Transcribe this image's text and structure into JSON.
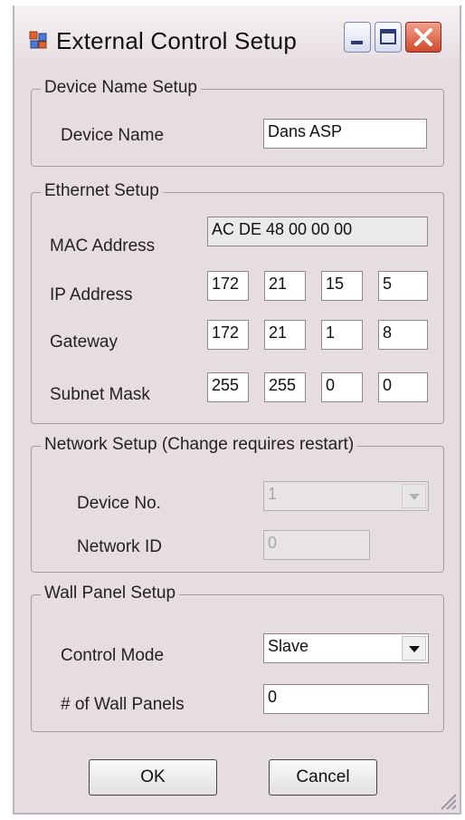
{
  "window": {
    "title": "External Control Setup"
  },
  "device_name_setup": {
    "legend": "Device Name Setup",
    "device_name_label": "Device Name",
    "device_name_value": "Dans ASP"
  },
  "ethernet_setup": {
    "legend": "Ethernet Setup",
    "mac_label": "MAC Address",
    "mac_value": "AC DE 48 00 00 00",
    "ip_label": "IP Address",
    "ip": [
      "172",
      "21",
      "15",
      "5"
    ],
    "gateway_label": "Gateway",
    "gateway": [
      "172",
      "21",
      "1",
      "8"
    ],
    "subnet_label": "Subnet Mask",
    "subnet": [
      "255",
      "255",
      "0",
      "0"
    ]
  },
  "network_setup": {
    "legend": "Network Setup (Change requires restart)",
    "device_no_label": "Device No.",
    "device_no_value": "1",
    "network_id_label": "Network ID",
    "network_id_value": "0"
  },
  "wall_panel_setup": {
    "legend": "Wall Panel Setup",
    "control_mode_label": "Control Mode",
    "control_mode_value": "Slave",
    "wall_panels_label": "# of Wall Panels",
    "wall_panels_value": "0"
  },
  "buttons": {
    "ok": "OK",
    "cancel": "Cancel"
  },
  "icons": {
    "app": "app-window-icon",
    "minimize": "minimize-icon",
    "maximize": "maximize-icon",
    "close": "close-icon",
    "dropdown": "chevron-down-icon",
    "grip": "resize-grip-icon"
  }
}
